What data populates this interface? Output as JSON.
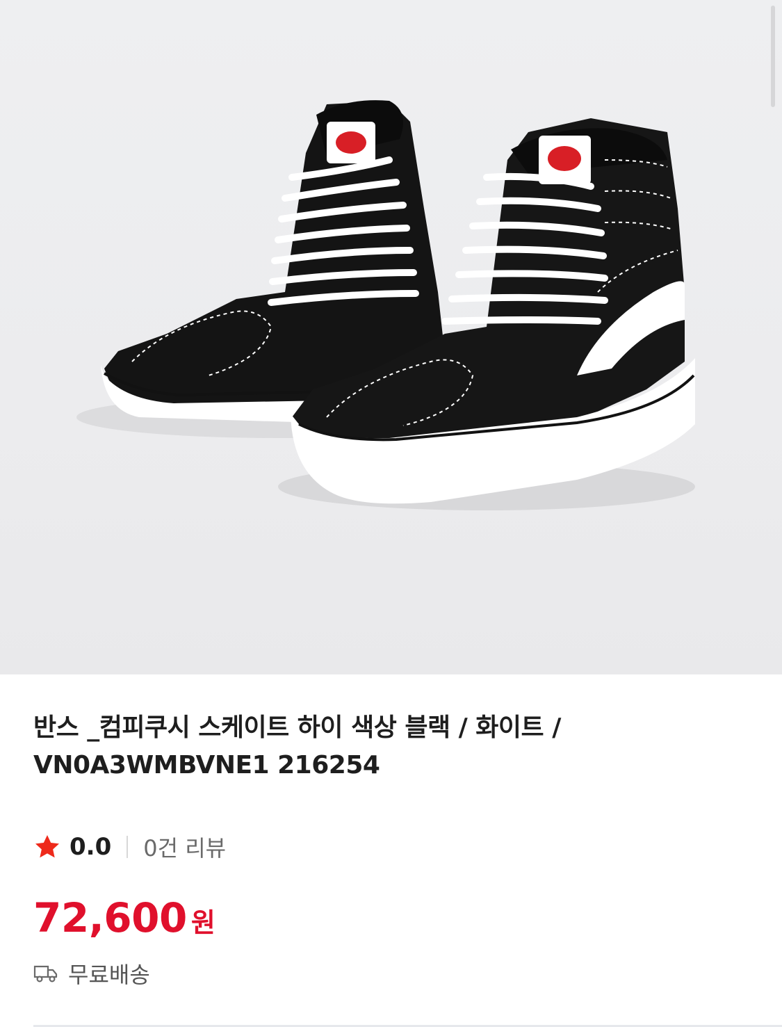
{
  "product": {
    "title_line1": "반스 _컴피쿠시 스케이트 하이 색상 블랙 / 화이트 /",
    "title_line2": "VN0A3WMBVNE1 216254",
    "rating": "0.0",
    "review_count_text": "0건 리뷰",
    "price": "72,600",
    "currency": "원",
    "shipping": "무료배송"
  },
  "icons": {
    "rating": "star-icon",
    "shipping": "truck-icon"
  },
  "colors": {
    "price": "#e0102c",
    "star": "#ee2a1b"
  }
}
